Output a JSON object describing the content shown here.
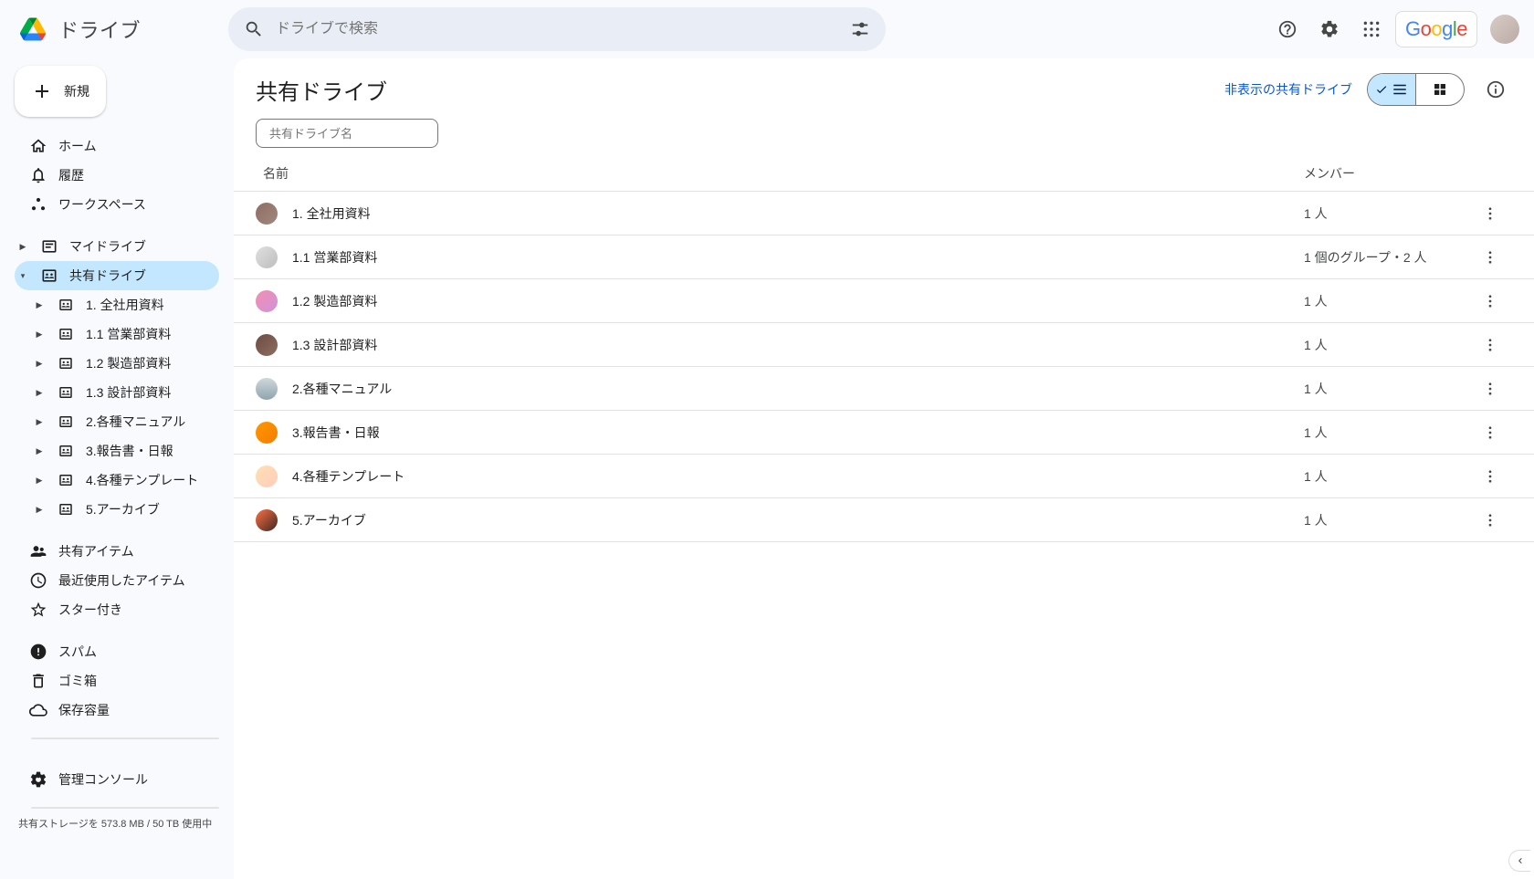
{
  "app": {
    "name": "ドライブ",
    "searchPlaceholder": "ドライブで検索",
    "googleLabel": "Google"
  },
  "newButton": {
    "label": "新規"
  },
  "nav": {
    "home": "ホーム",
    "activity": "履歴",
    "workspaces": "ワークスペース",
    "myDrive": "マイドライブ",
    "sharedDrives": "共有ドライブ",
    "sharedDrivesChildren": [
      "1. 全社用資料",
      "1.1 営業部資料",
      "1.2 製造部資料",
      "1.3 設計部資料",
      "2.各種マニュアル",
      "3.報告書・日報",
      "4.各種テンプレート",
      "5.アーカイブ"
    ],
    "sharedWithMe": "共有アイテム",
    "recent": "最近使用したアイテム",
    "starred": "スター付き",
    "spam": "スパム",
    "trash": "ゴミ箱",
    "storage": "保存容量",
    "adminConsole": "管理コンソール",
    "storageText": "共有ストレージを 573.8 MB / 50 TB 使用中"
  },
  "main": {
    "title": "共有ドライブ",
    "hiddenLink": "非表示の共有ドライブ",
    "filterPlaceholder": "共有ドライブ名",
    "columns": {
      "name": "名前",
      "members": "メンバー"
    },
    "rows": [
      {
        "name": "1. 全社用資料",
        "members": "1 人",
        "thumb": "linear-gradient(135deg,#8d6e63,#a1887f)"
      },
      {
        "name": "1.1 営業部資料",
        "members": "1 個のグループ・2 人",
        "thumb": "linear-gradient(135deg,#e0e0e0,#bdbdbd)"
      },
      {
        "name": "1.2 製造部資料",
        "members": "1 人",
        "thumb": "linear-gradient(135deg,#f48fb1,#ce93d8)"
      },
      {
        "name": "1.3 設計部資料",
        "members": "1 人",
        "thumb": "linear-gradient(135deg,#6d4c41,#8d6e63)"
      },
      {
        "name": "2.各種マニュアル",
        "members": "1 人",
        "thumb": "linear-gradient(180deg,#cfd8dc,#90a4ae)"
      },
      {
        "name": "3.報告書・日報",
        "members": "1 人",
        "thumb": "linear-gradient(135deg,#ff9800,#f57c00)"
      },
      {
        "name": "4.各種テンプレート",
        "members": "1 人",
        "thumb": "linear-gradient(135deg,#ffe0b2,#ffccbc)"
      },
      {
        "name": "5.アーカイブ",
        "members": "1 人",
        "thumb": "linear-gradient(135deg,#ff7043,#3e2723)"
      }
    ]
  }
}
